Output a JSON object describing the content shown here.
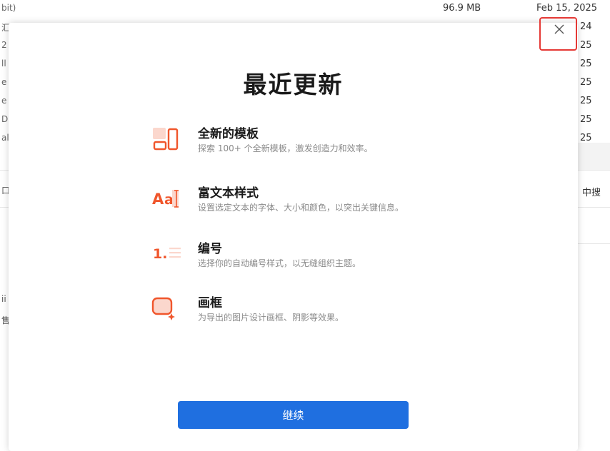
{
  "background": {
    "rows": [
      {
        "left": "bit)",
        "size": "96.9 MB",
        "date": "Feb 15, 2025"
      },
      {
        "left": "汇",
        "date": "24"
      },
      {
        "left": "2",
        "date": "25"
      },
      {
        "left": "ll",
        "date": "25"
      },
      {
        "left": "e",
        "date": "25"
      },
      {
        "left": "e",
        "date": "25"
      },
      {
        "left": "D",
        "date": "25"
      },
      {
        "left": "al",
        "date": "25"
      }
    ],
    "right_label": "中搜",
    "left_fragments": [
      "口",
      "ii",
      "售"
    ]
  },
  "modal": {
    "title": "最近更新",
    "close_icon": "close-icon",
    "features": [
      {
        "icon": "template-icon",
        "title": "全新的模板",
        "desc": "探索 100+ 个全新模板，激发创造力和效率。"
      },
      {
        "icon": "rich-text-icon",
        "title": "富文本样式",
        "desc": "设置选定文本的字体、大小和颜色，以突出关键信息。"
      },
      {
        "icon": "numbering-icon",
        "title": "编号",
        "desc": "选择你的自动编号样式，以无缝组织主题。"
      },
      {
        "icon": "frame-icon",
        "title": "画框",
        "desc": "为导出的图片设计画框、阴影等效果。"
      }
    ],
    "continue_label": "继续"
  },
  "colors": {
    "accent": "#1f6fe0",
    "icon_orange": "#f0562c",
    "icon_light": "#fbd7cd",
    "highlight_red": "#e53935"
  }
}
